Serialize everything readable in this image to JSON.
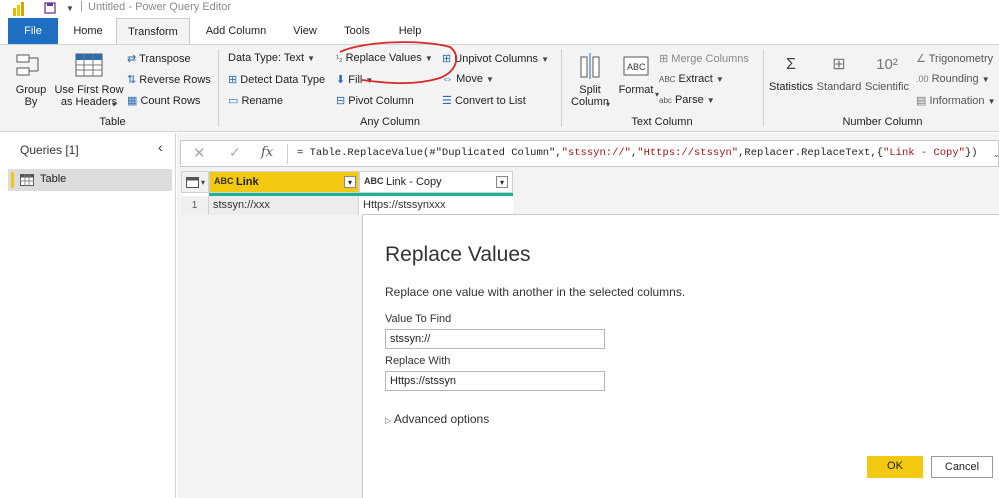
{
  "window": {
    "title": "Untitled - Power Query Editor"
  },
  "tabs": [
    {
      "label": "File"
    },
    {
      "label": "Home"
    },
    {
      "label": "Transform"
    },
    {
      "label": "Add Column"
    },
    {
      "label": "View"
    },
    {
      "label": "Tools"
    },
    {
      "label": "Help"
    }
  ],
  "ribbon": {
    "table": {
      "group_label": "Table",
      "group_by": "Group\nBy",
      "use_first_row": "Use First Row\nas Headers",
      "transpose": "Transpose",
      "reverse_rows": "Reverse Rows",
      "count_rows": "Count Rows"
    },
    "any_column": {
      "group_label": "Any Column",
      "data_type": "Data Type: Text",
      "detect_data_type": "Detect Data Type",
      "rename": "Rename",
      "replace_values": "Replace Values",
      "fill": "Fill",
      "pivot_column": "Pivot Column",
      "unpivot_columns": "Unpivot Columns",
      "move": "Move",
      "convert_to_list": "Convert to List"
    },
    "text_column": {
      "group_label": "Text Column",
      "split_column": "Split\nColumn",
      "format": "Format",
      "merge_columns": "Merge Columns",
      "extract": "Extract",
      "parse": "Parse"
    },
    "number_column": {
      "group_label": "Number Column",
      "statistics": "Statistics",
      "standard": "Standard",
      "scientific": "Scientific",
      "trigonometry": "Trigonometry",
      "rounding": "Rounding",
      "information": "Information"
    },
    "highlight_color": "#d62828"
  },
  "queries_pane": {
    "title": "Queries [1]",
    "items": [
      {
        "name": "Table"
      }
    ]
  },
  "formula_bar": {
    "fx": "fx",
    "formula_prefix": "= Table.ReplaceValue(#\"Duplicated Column\",",
    "arg1": "\"stssyn://\"",
    "comma1": ",",
    "arg2": "\"Https://stssyn\"",
    "mid": ",Replacer.ReplaceText,{",
    "arg3": "\"Link - Copy\"",
    "suffix": "})"
  },
  "grid": {
    "columns": [
      {
        "name": "Link",
        "type_icon": "ABC"
      },
      {
        "name": "Link - Copy",
        "type_icon": "ABC"
      }
    ],
    "rows": [
      {
        "index": "1",
        "cells": [
          "stssyn://xxx",
          "Https://stssynxxx"
        ]
      }
    ],
    "header_active_color": "#f2c811",
    "quality_bar_color": "#1ab394"
  },
  "dialog": {
    "title": "Replace Values",
    "description": "Replace one value with another in the selected columns.",
    "value_to_find_label": "Value To Find",
    "value_to_find": "stssyn://",
    "replace_with_label": "Replace With",
    "replace_with": "Https://stssyn",
    "advanced_options": "Advanced options",
    "ok": "OK",
    "cancel": "Cancel",
    "ok_color": "#f2c811"
  }
}
